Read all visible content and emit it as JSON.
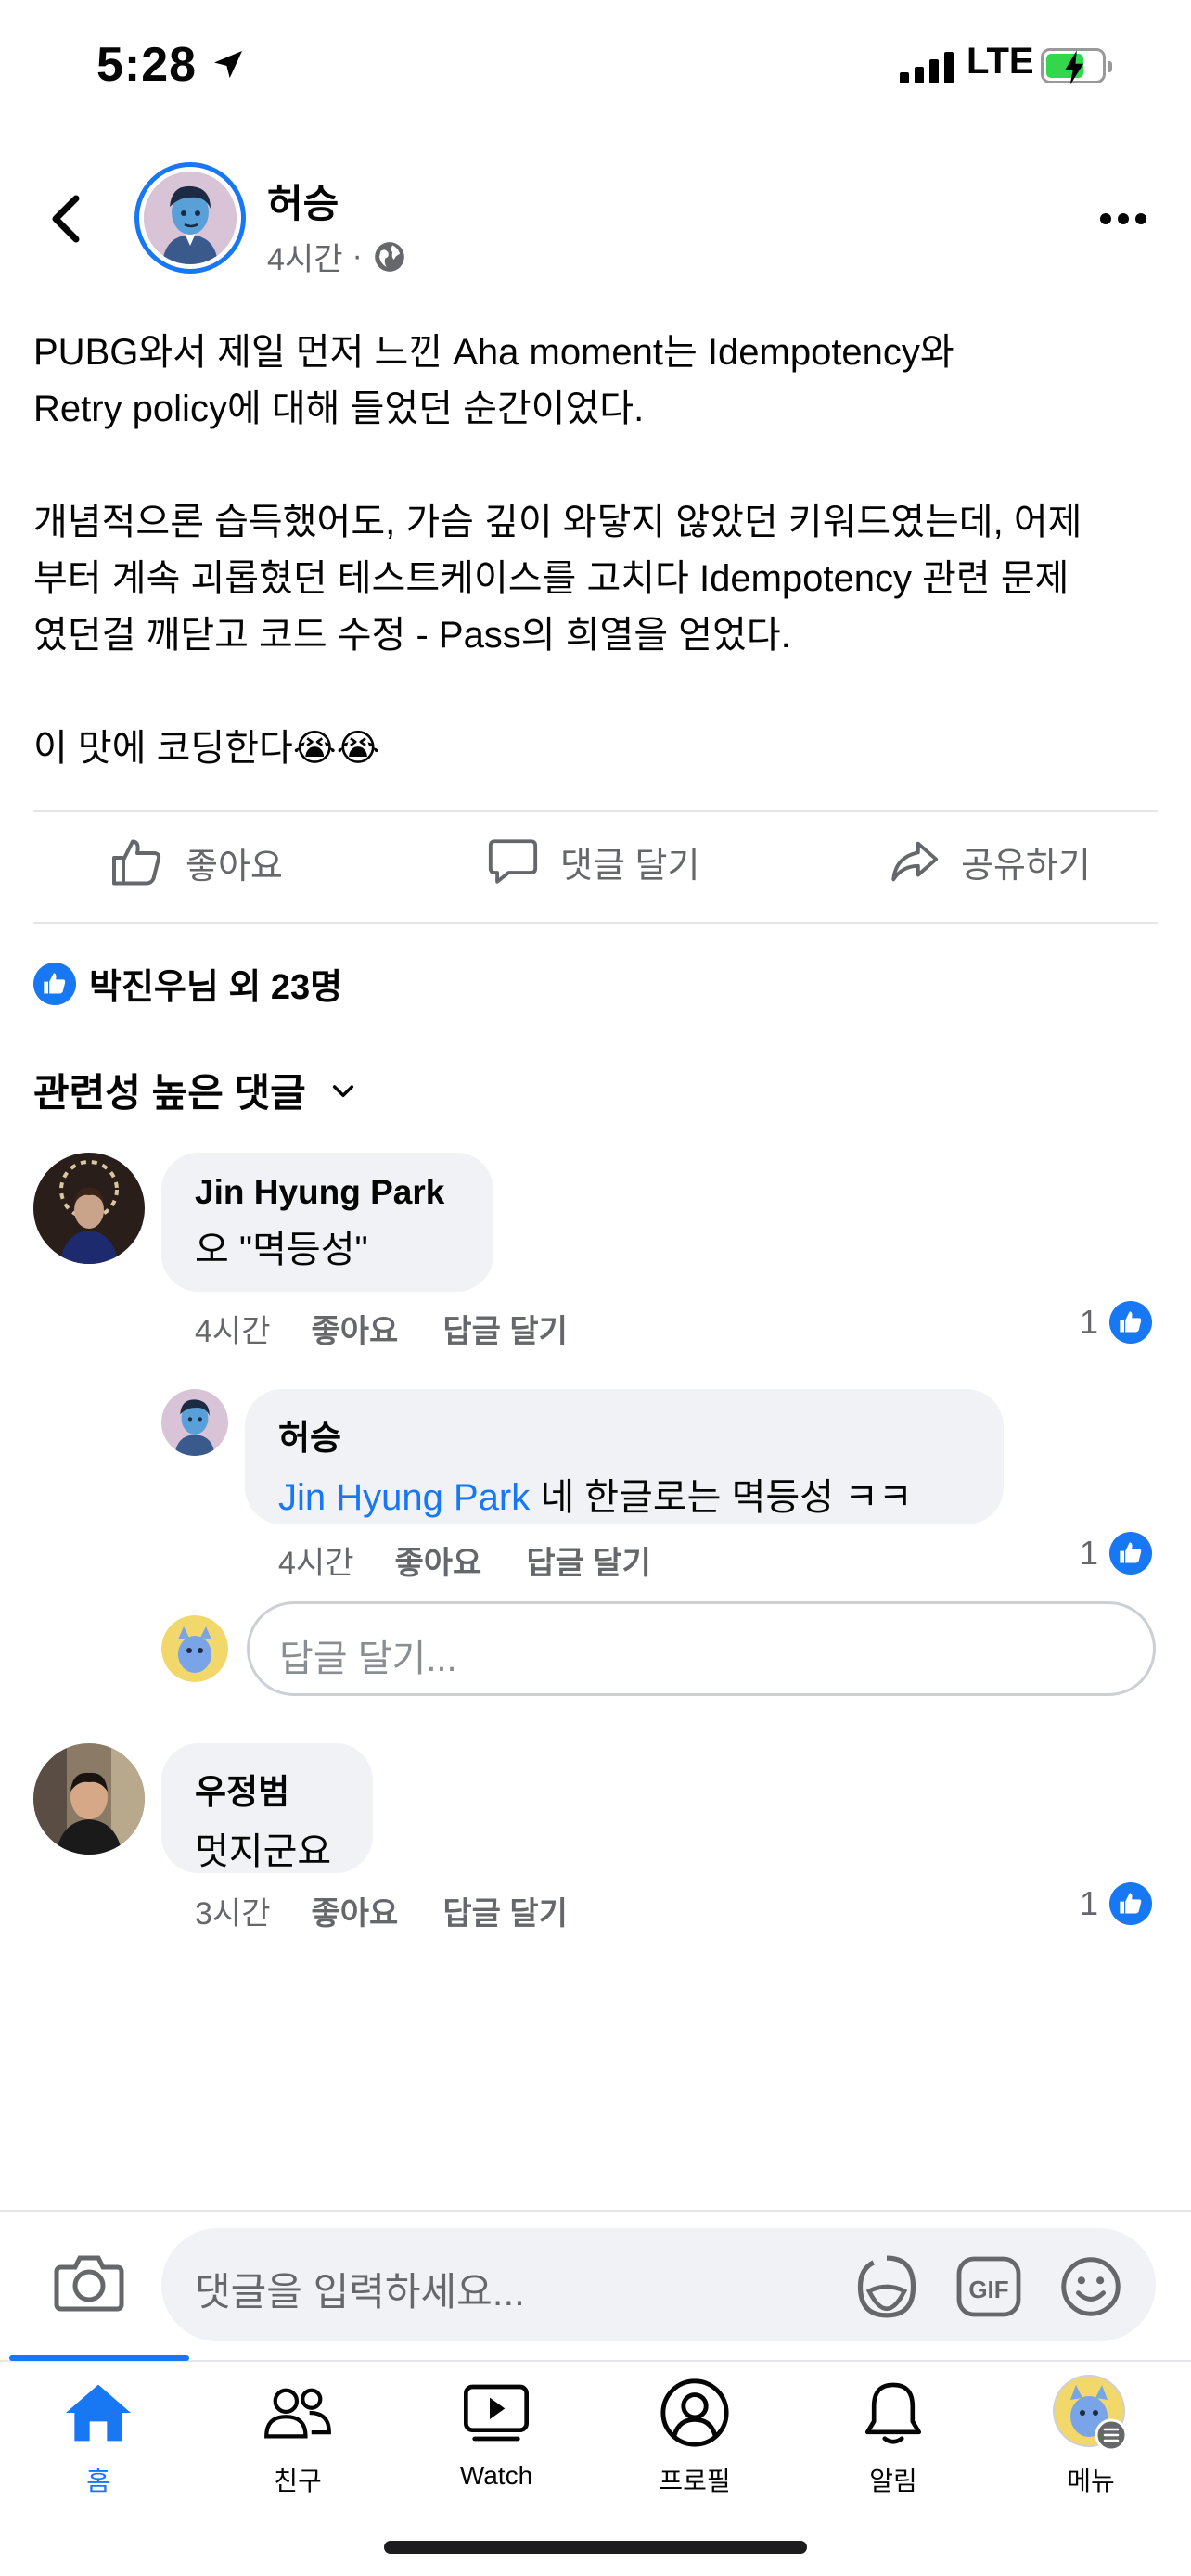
{
  "status_bar": {
    "time": "5:28",
    "network": "LTE"
  },
  "post": {
    "author": "허승",
    "time": "4시간",
    "separator": "·",
    "text": "PUBG와서 제일 먼저 느낀 Aha moment는 Idempotency와\nRetry policy에 대해 들었던 순간이었다.\n\n개념적으론 습득했어도, 가슴 깊이 와닿지 않았던 키워드였는데, 어제\n부터 계속 괴롭혔던 테스트케이스를 고치다 Idempotency 관련 문제\n였던걸 깨닫고 코드 수정 - Pass의 희열을 얻었다.\n\n이 맛에 코딩한다😭😭"
  },
  "actions": {
    "like": "좋아요",
    "comment": "댓글 달기",
    "share": "공유하기"
  },
  "reactions": {
    "summary": "박진우님 외 23명"
  },
  "comments_sort": {
    "label": "관련성 높은 댓글"
  },
  "comments": [
    {
      "name": "Jin Hyung Park",
      "text": "오 \"멱등성\"",
      "time": "4시간",
      "like": "좋아요",
      "reply": "답글 달기",
      "likes": "1"
    },
    {
      "name": "허승",
      "mention": "Jin Hyung Park",
      "text": " 네 한글로는 멱등성 ㅋㅋ",
      "time": "4시간",
      "like": "좋아요",
      "reply": "답글 달기",
      "likes": "1"
    },
    {
      "name": "우정범",
      "text": "멋지군요",
      "time": "3시간",
      "like": "좋아요",
      "reply": "답글 달기",
      "likes": "1"
    }
  ],
  "reply_input": {
    "placeholder": "답글 달기..."
  },
  "composer": {
    "placeholder": "댓글을 입력하세요..."
  },
  "tabs": [
    {
      "label": "홈",
      "icon": "home-icon"
    },
    {
      "label": "친구",
      "icon": "friends-icon"
    },
    {
      "label": "Watch",
      "icon": "watch-icon"
    },
    {
      "label": "프로필",
      "icon": "profile-icon"
    },
    {
      "label": "알림",
      "icon": "bell-icon"
    },
    {
      "label": "메뉴",
      "icon": "menu-avatar"
    }
  ],
  "colors": {
    "accent": "#1877f2",
    "bubble": "#f0f2f5",
    "muted": "#65676b"
  }
}
